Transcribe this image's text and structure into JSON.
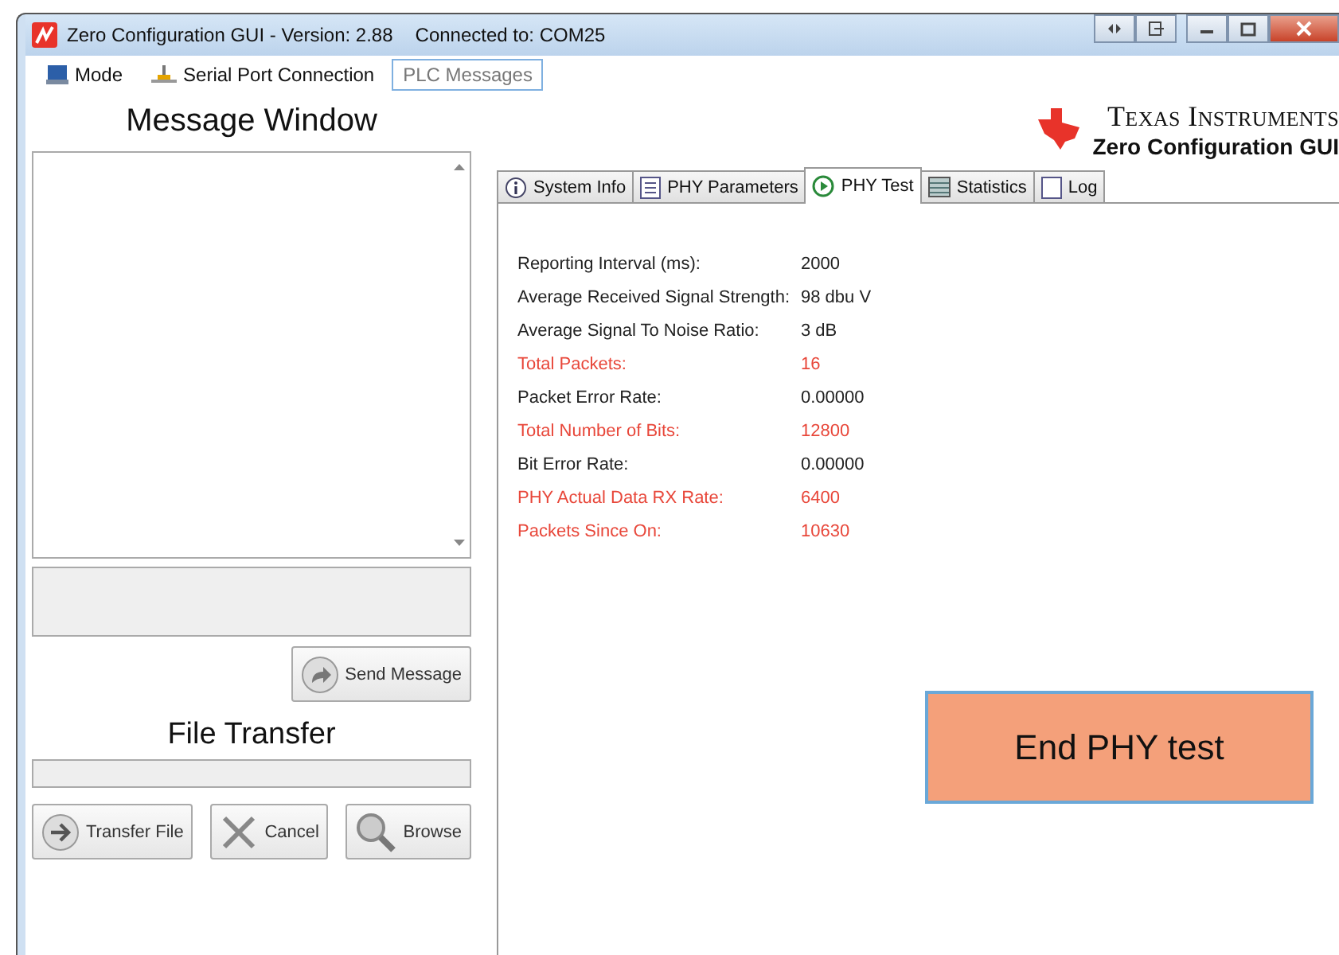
{
  "window": {
    "title": "Zero Configuration GUI - Version: 2.88",
    "connection": "Connected to: COM25"
  },
  "menu": [
    {
      "label": "Mode",
      "selected": false
    },
    {
      "label": "Serial Port Connection",
      "selected": false
    },
    {
      "label": "PLC Messages",
      "selected": true
    }
  ],
  "message_window": {
    "title": "Message Window",
    "send_button": "Send Message"
  },
  "file_transfer": {
    "title": "File Transfer",
    "buttons": [
      "Transfer File",
      "Cancel",
      "Browse"
    ]
  },
  "logo": {
    "brand": "Texas Instruments",
    "subtitle": "Zero Configuration GUI"
  },
  "tabs": [
    {
      "label": "System Info",
      "selected": false
    },
    {
      "label": "PHY Parameters",
      "selected": false
    },
    {
      "label": "PHY Test",
      "selected": true
    },
    {
      "label": "Statistics",
      "selected": false
    },
    {
      "label": "Log",
      "selected": false
    }
  ],
  "phy_test": {
    "rows": [
      {
        "label": "Reporting Interval (ms):",
        "value": "2000",
        "highlighted": false
      },
      {
        "label": "Average Received Signal Strength:",
        "value": "98 dbu V",
        "highlighted": false
      },
      {
        "label": "Average Signal To Noise Ratio:",
        "value": "3 dB",
        "highlighted": false
      },
      {
        "label": "Total Packets:",
        "value": "16",
        "highlighted": true
      },
      {
        "label": "Packet Error Rate:",
        "value": "0.00000",
        "highlighted": false
      },
      {
        "label": "Total Number of Bits:",
        "value": "12800",
        "highlighted": true
      },
      {
        "label": "Bit Error Rate:",
        "value": "0.00000",
        "highlighted": false
      },
      {
        "label": "PHY Actual Data RX Rate:",
        "value": "6400",
        "highlighted": true
      },
      {
        "label": "Packets Since On:",
        "value": "10630",
        "highlighted": true
      }
    ],
    "end_button": "End PHY test"
  }
}
